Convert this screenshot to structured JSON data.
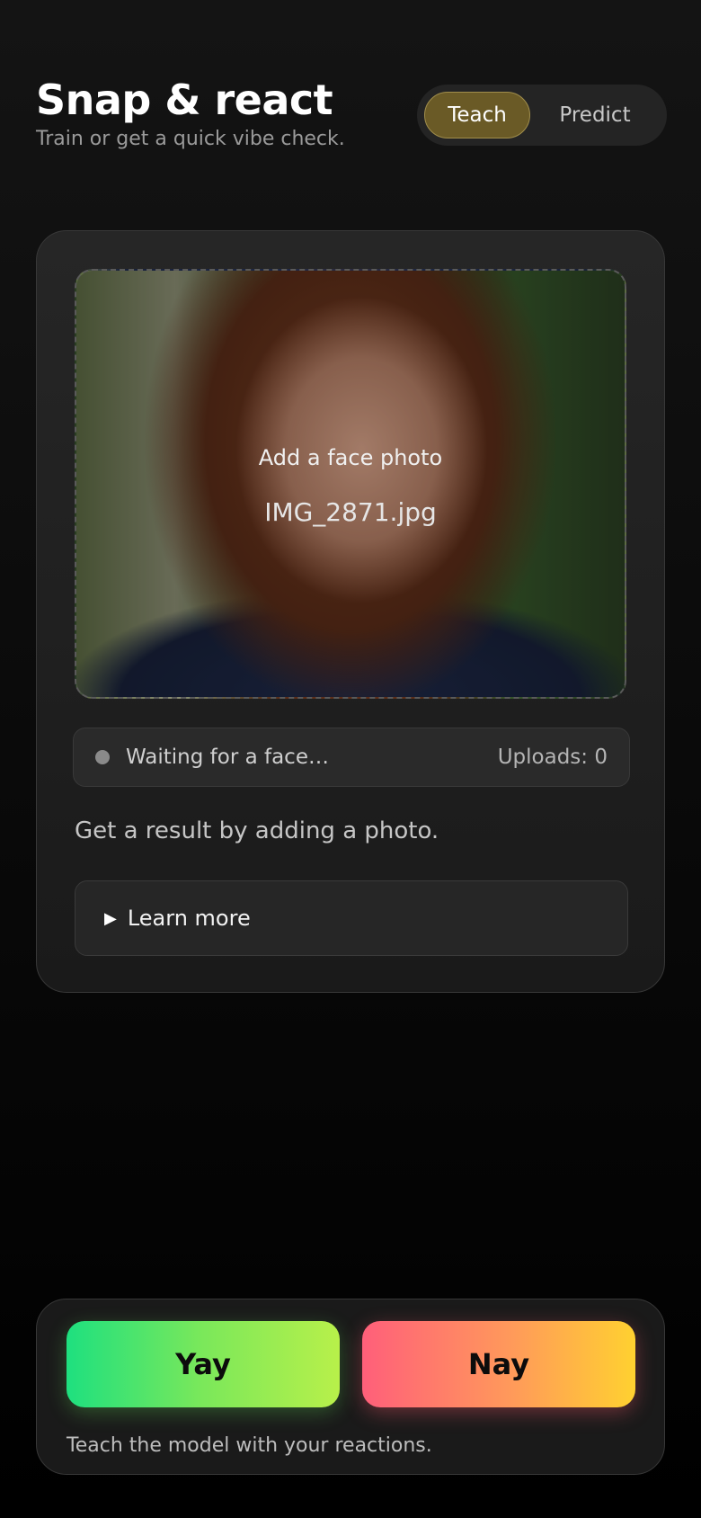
{
  "header": {
    "title": "Snap & react",
    "subtitle": "Train or get a quick vibe check."
  },
  "mode_toggle": {
    "options": [
      "Teach",
      "Predict"
    ],
    "selected": "Teach"
  },
  "photo": {
    "label": "Add a face photo",
    "filename": "IMG_2871.jpg"
  },
  "status": {
    "text": "Waiting for a face…",
    "uploads": "Uploads: 0",
    "dot_color": "#8a8a8a"
  },
  "result_text": "Get a result by adding a photo.",
  "learn_more": {
    "label": "Learn more"
  },
  "reactions": {
    "yay_label": "Yay",
    "nay_label": "Nay",
    "hint": "Teach the model with your reactions."
  },
  "colors": {
    "accent": "#6a5a26",
    "yay_gradient": [
      "#1ee07f",
      "#b8f04a"
    ],
    "nay_gradient": [
      "#ff5f7a",
      "#ffd130"
    ]
  }
}
